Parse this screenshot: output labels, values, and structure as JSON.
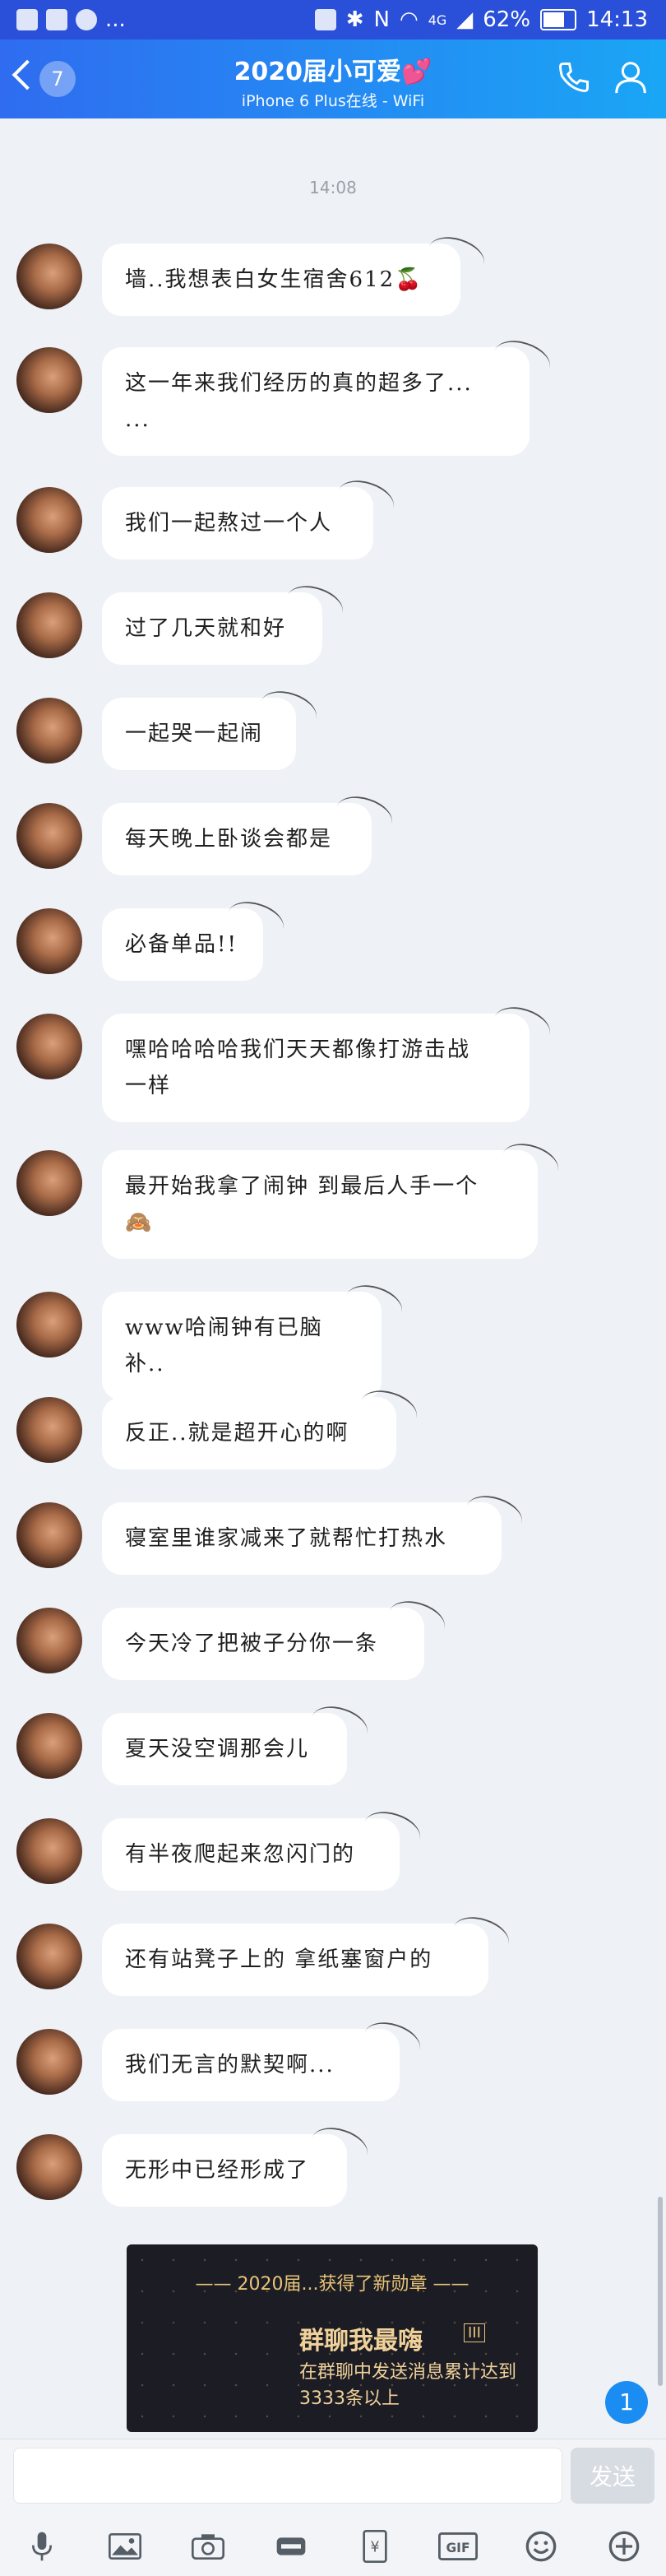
{
  "status_bar": {
    "left_more": "...",
    "battery": "62%",
    "time": "14:13",
    "network": "4G"
  },
  "header": {
    "unread_count": "7",
    "title": "2020届小可爱💕",
    "subtitle": "iPhone 6 Plus在线 - WiFi"
  },
  "timestamp": "14:08",
  "messages": [
    {
      "text": "墙..我想表白女生宿舍612🍒"
    },
    {
      "text": "这一年来我们经历的真的超多了...\n..."
    },
    {
      "text": "我们一起熬过一个人"
    },
    {
      "text": "过了几天就和好"
    },
    {
      "text": "一起哭一起闹"
    },
    {
      "text": "每天晚上卧谈会都是"
    },
    {
      "text": "必备单品!!"
    },
    {
      "text": "嘿哈哈哈哈我们天天都像打游击战\n一样"
    },
    {
      "text": "最开始我拿了闹钟 到最后人手一个\n🙈"
    },
    {
      "text": "www哈闹钟有已脑补.."
    },
    {
      "text": "反正..就是超开心的啊"
    },
    {
      "text": "寝室里谁家减来了就帮忙打热水"
    },
    {
      "text": "今天冷了把被子分你一条"
    },
    {
      "text": "夏天没空调那会儿"
    },
    {
      "text": "有半夜爬起来忽闪门的"
    },
    {
      "text": "还有站凳子上的 拿纸塞窗户的"
    },
    {
      "text": "我们无言的默契啊..."
    },
    {
      "text": "无形中已经形成了"
    }
  ],
  "medal_card": {
    "headline": "—— 2020届...获得了新勋章 ——",
    "name": "群聊我最嗨",
    "level": "III",
    "description": "在群聊中发送消息累计达到3333条以上"
  },
  "new_message_badge": "1",
  "input": {
    "placeholder": "",
    "send_label": "发送"
  },
  "toolbar": {
    "icons": [
      "microphone-icon",
      "image-icon",
      "camera-icon",
      "red-packet-icon",
      "transfer-icon",
      "gif-icon",
      "emoji-icon",
      "plus-icon"
    ],
    "gif_label": "GIF",
    "yen_label": "¥"
  }
}
